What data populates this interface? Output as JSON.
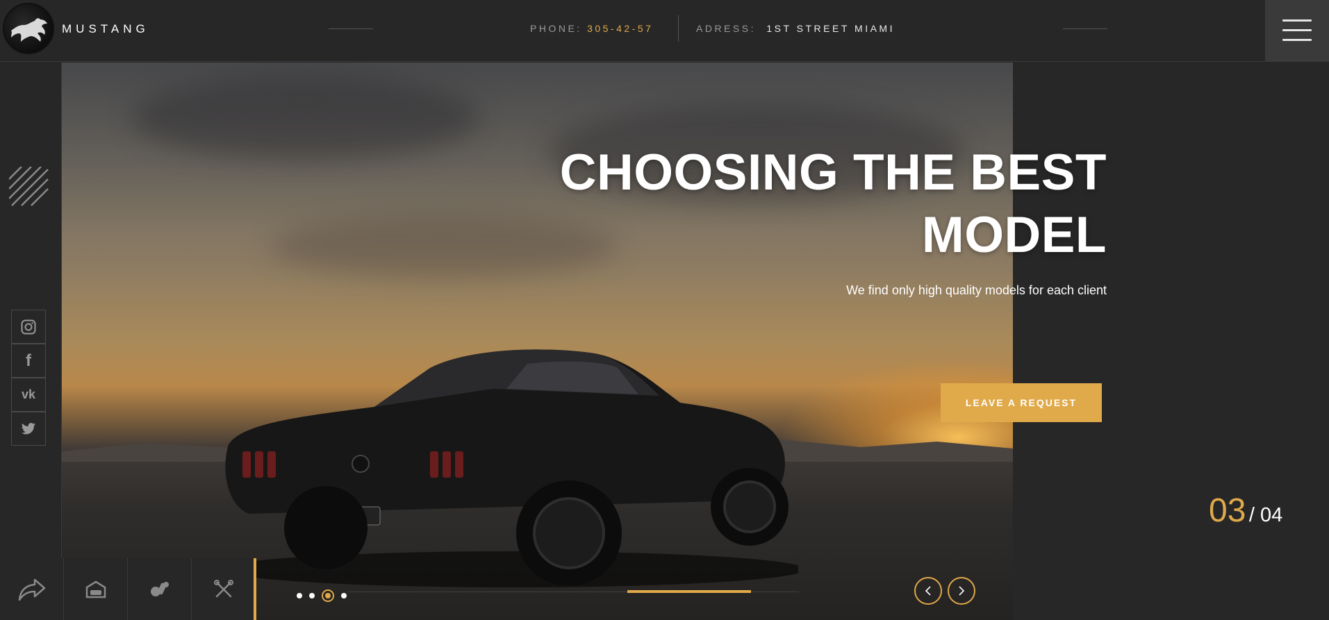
{
  "brand": {
    "name": "MUSTANG",
    "logo_icon": "mustang-horse-icon"
  },
  "header": {
    "phone_label": "PHONE:",
    "phone_value": "305-42-57",
    "address_label": "ADRESS:",
    "address_value": "1ST STREET MIAMI",
    "menu_icon": "hamburger-menu-icon"
  },
  "social": [
    {
      "name": "instagram",
      "icon": "instagram-icon"
    },
    {
      "name": "facebook",
      "icon": "facebook-icon",
      "glyph": "f"
    },
    {
      "name": "vk",
      "icon": "vk-icon",
      "glyph": "vk"
    },
    {
      "name": "twitter",
      "icon": "twitter-icon"
    }
  ],
  "hero": {
    "title_line1": "CHOOSING THE BEST",
    "title_line2": "MODEL",
    "subtitle": "We find only high quality models for each client",
    "cta": "LEAVE A REQUEST"
  },
  "slider": {
    "current": "03",
    "total": "/ 04",
    "dot_count": 4,
    "active_dot": 3
  },
  "bottom_nav": [
    {
      "icon": "share-arrow-icon"
    },
    {
      "icon": "garage-car-icon"
    },
    {
      "icon": "engine-parts-icon"
    },
    {
      "icon": "tools-wrench-icon"
    }
  ],
  "colors": {
    "accent": "#e0a94a",
    "background": "#272727",
    "panel": "#3a3a3a"
  }
}
